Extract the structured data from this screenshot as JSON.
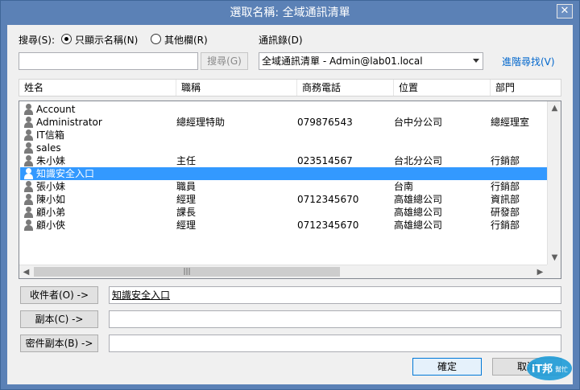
{
  "window": {
    "title": "選取名稱: 全域通訊清單",
    "close_glyph": "✕"
  },
  "search": {
    "label": "搜尋(S):",
    "option_name_only": "只顯示名稱(N)",
    "option_other_columns": "其他欄(R)",
    "selected_option": "只顯示名稱(N)",
    "query_value": "",
    "go_button": "搜尋(G)"
  },
  "address_book": {
    "label": "通訊錄(D)",
    "selected": "全域通訊清單 - Admin@lab01.local",
    "advanced_find": "進階尋找(V)"
  },
  "table": {
    "columns": [
      "姓名",
      "職稱",
      "商務電話",
      "位置",
      "部門"
    ],
    "rows": [
      {
        "name": "Account",
        "title": "",
        "phone": "",
        "location": "",
        "dept": "",
        "selected": false
      },
      {
        "name": "Administrator",
        "title": "總經理特助",
        "phone": "079876543",
        "location": "台中分公司",
        "dept": "總經理室",
        "selected": false
      },
      {
        "name": "IT信箱",
        "title": "",
        "phone": "",
        "location": "",
        "dept": "",
        "selected": false
      },
      {
        "name": "sales",
        "title": "",
        "phone": "",
        "location": "",
        "dept": "",
        "selected": false
      },
      {
        "name": "朱小妹",
        "title": "主任",
        "phone": "023514567",
        "location": "台北分公司",
        "dept": "行銷部",
        "selected": false
      },
      {
        "name": "知識安全入口",
        "title": "",
        "phone": "",
        "location": "",
        "dept": "",
        "selected": true
      },
      {
        "name": "張小妹",
        "title": "職員",
        "phone": "",
        "location": "台南",
        "dept": "行銷部",
        "selected": false
      },
      {
        "name": "陳小如",
        "title": "經理",
        "phone": "0712345670",
        "location": "高雄總公司",
        "dept": "資訊部",
        "selected": false
      },
      {
        "name": "顧小弟",
        "title": "課長",
        "phone": "",
        "location": "高雄總公司",
        "dept": "研發部",
        "selected": false
      },
      {
        "name": "顧小俠",
        "title": "經理",
        "phone": "0712345670",
        "location": "高雄總公司",
        "dept": "行銷部",
        "selected": false
      }
    ]
  },
  "recipients": {
    "to_button": "收件者(O) ->",
    "to_value": "知識安全入口",
    "cc_button": "副本(C) ->",
    "cc_value": "",
    "bcc_button": "密件副本(B) ->",
    "bcc_value": ""
  },
  "footer": {
    "ok": "確定",
    "cancel": "取消"
  },
  "logo": {
    "text": "iT邦",
    "subtext": "幫忙"
  },
  "colors": {
    "title_bar": "#5b81b6",
    "selection": "#3399ff",
    "link": "#0066cc"
  }
}
